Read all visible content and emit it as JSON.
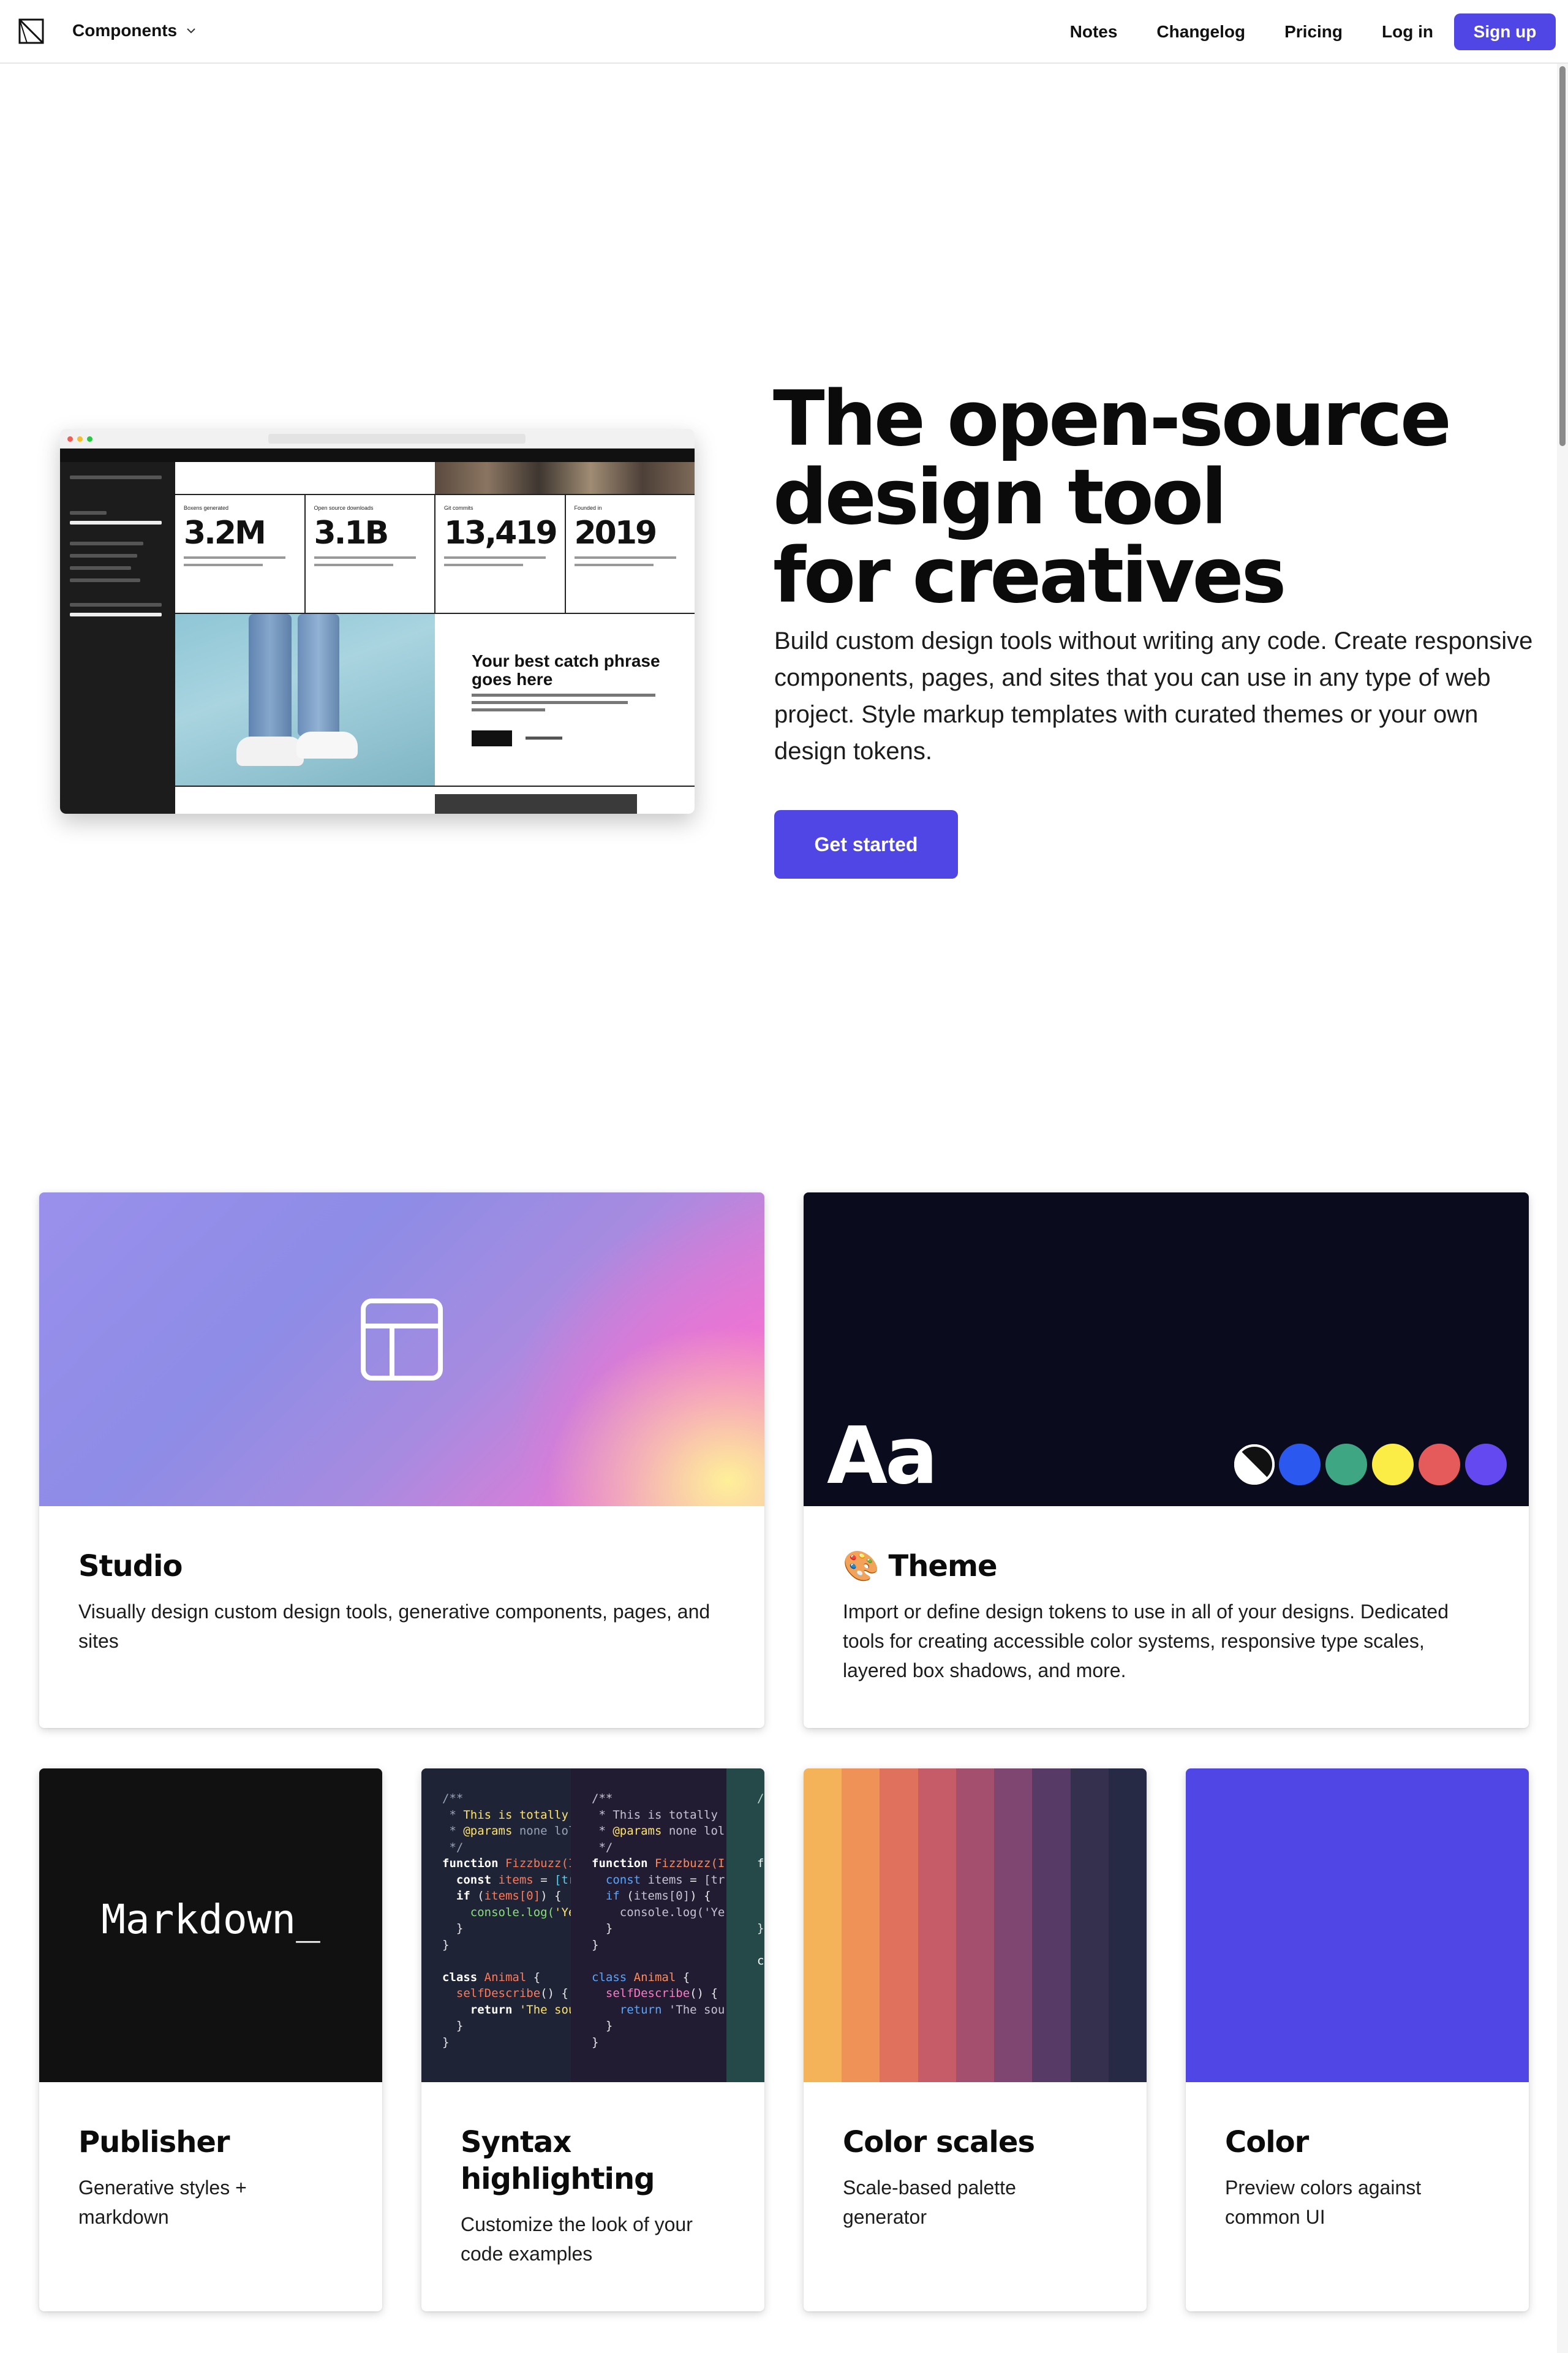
{
  "nav": {
    "menu_label": "Components",
    "links": [
      "Notes",
      "Changelog",
      "Pricing",
      "Log in"
    ],
    "signup_label": "Sign up"
  },
  "hero": {
    "title_lines": [
      "The open-source",
      "design tool",
      "for creatives"
    ],
    "description": "Build custom design tools without writing any code. Create responsive components, pages, and sites that you can use in any type of web project. Style markup templates with curated themes or your own design tokens.",
    "cta_label": "Get started",
    "preview": {
      "stats": [
        {
          "label": "Boxens generated",
          "value": "3.2M"
        },
        {
          "label": "Open source downloads",
          "value": "3.1B"
        },
        {
          "label": "Git commits",
          "value": "13,419"
        },
        {
          "label": "Founded in",
          "value": "2019"
        }
      ],
      "catch_phrase": "Your best catch phrase goes here"
    }
  },
  "cards": {
    "studio": {
      "title": "Studio",
      "description": "Visually design custom design tools, generative components, pages, and sites",
      "icon": "layout-icon"
    },
    "theme": {
      "emoji": "🎨",
      "title": "Theme",
      "description": "Import or define design tokens to use in all of your designs. Dedicated tools for creating accessible color systems, responsive type scales, layered box shadows, and more.",
      "sample_text": "Aa",
      "swatches": [
        "#2b59f0",
        "#3fa683",
        "#fbec46",
        "#e55a5a",
        "#6549f0"
      ]
    },
    "publisher": {
      "title": "Publisher",
      "description": "Generative styles + markdown",
      "preview_text": "Markdown_"
    },
    "syntax": {
      "title_lines": [
        "Syntax",
        "highlighting"
      ],
      "description": "Customize the look of your code examples"
    },
    "scales": {
      "title": "Color scales",
      "description": "Scale-based palette generator",
      "colors": [
        "#f4b259",
        "#ee9258",
        "#e0725d",
        "#c55c67",
        "#a34f6d",
        "#7e4670",
        "#573b66",
        "#36304f",
        "#262a45"
      ]
    },
    "color": {
      "title": "Color",
      "description": "Preview colors against common UI",
      "fill": "#4f46e5"
    }
  }
}
